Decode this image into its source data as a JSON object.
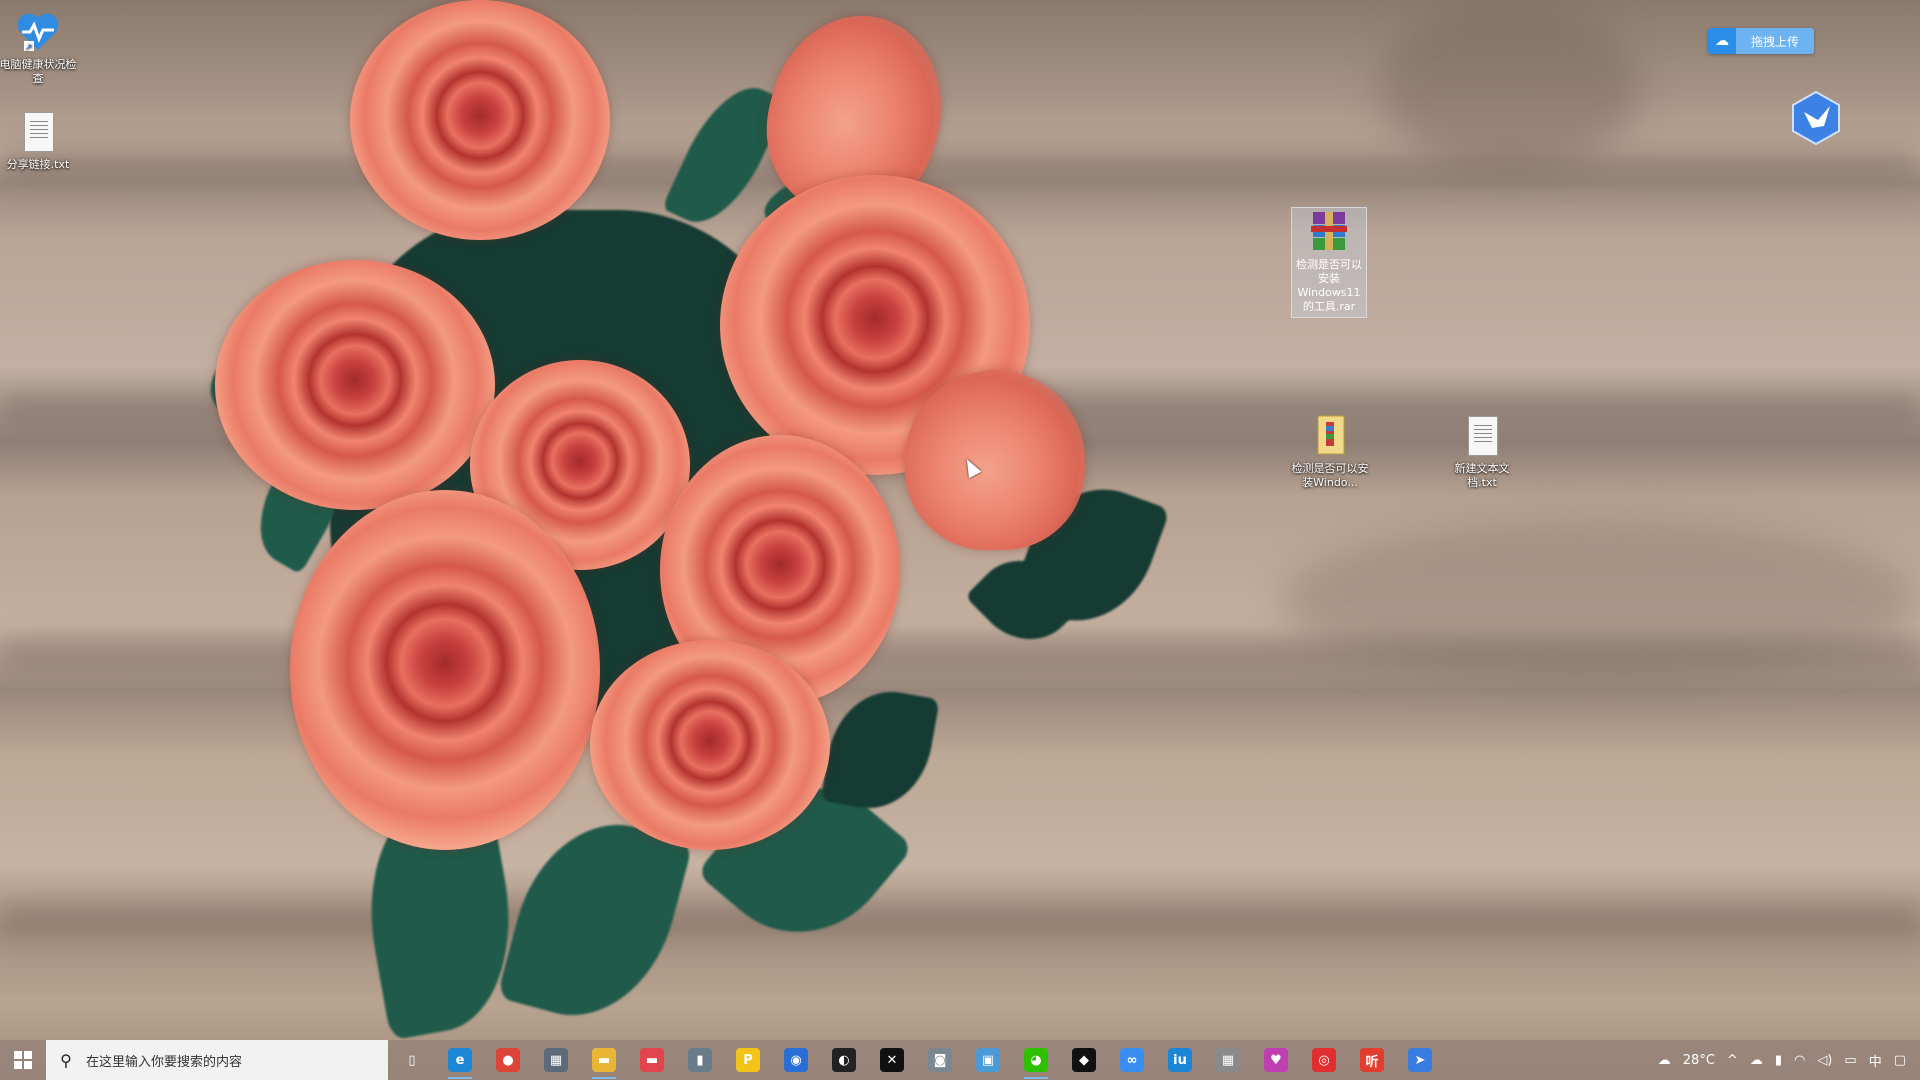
{
  "desktop": {
    "icons": [
      {
        "label": "电脑健康状况检查",
        "icon": "heart-monitor-icon"
      },
      {
        "label": "分享链接.txt",
        "icon": "text-file-icon"
      },
      {
        "label": "检测是否可以安装Windows11的工具.rar",
        "icon": "winrar-archive-icon"
      },
      {
        "label": "检测是否可以安装Windo...",
        "icon": "folder-zip-icon"
      },
      {
        "label": "新建文本文档.txt",
        "icon": "text-file-icon"
      }
    ]
  },
  "widgets": {
    "upload_label": "拖拽上传",
    "upload_icon": "baidu-cloud-icon",
    "bird_icon": "bird-app-icon"
  },
  "taskbar": {
    "search_placeholder": "在这里输入你要搜索的内容",
    "apps": [
      {
        "name": "task-view",
        "icon": "task-view-icon",
        "glyph": "▯",
        "color": "transparent"
      },
      {
        "name": "edge",
        "icon": "edge-icon",
        "glyph": "e",
        "color": "#1e88d6"
      },
      {
        "name": "chrome",
        "icon": "chrome-icon",
        "glyph": "●",
        "color": "#db4437"
      },
      {
        "name": "store",
        "icon": "store-icon",
        "glyph": "▦",
        "color": "#5c6a7a"
      },
      {
        "name": "explorer",
        "icon": "folder-icon",
        "glyph": "▬",
        "color": "#e8b534"
      },
      {
        "name": "app-red",
        "icon": "red-app-icon",
        "glyph": "▬",
        "color": "#e0464b"
      },
      {
        "name": "bottle",
        "icon": "bottle-icon",
        "glyph": "▮",
        "color": "#6a7c8c"
      },
      {
        "name": "player",
        "icon": "player-icon",
        "glyph": "P",
        "color": "#f2c318"
      },
      {
        "name": "browser",
        "icon": "globe-icon",
        "glyph": "◉",
        "color": "#2a6fd6"
      },
      {
        "name": "aperture",
        "icon": "aperture-icon",
        "glyph": "◐",
        "color": "#222222"
      },
      {
        "name": "capcut",
        "icon": "capcut-icon",
        "glyph": "✕",
        "color": "#111111"
      },
      {
        "name": "camera",
        "icon": "camera-icon",
        "glyph": "◙",
        "color": "#7a8894"
      },
      {
        "name": "screenshot",
        "icon": "screenshot-icon",
        "glyph": "▣",
        "color": "#4b9ad8"
      },
      {
        "name": "wechat",
        "icon": "wechat-icon",
        "glyph": "◕",
        "color": "#2dc100"
      },
      {
        "name": "qq",
        "icon": "qq-penguin-icon",
        "glyph": "◆",
        "color": "#111111"
      },
      {
        "name": "baidu-netdisk",
        "icon": "baidu-netdisk-icon",
        "glyph": "∞",
        "color": "#3a8ef0"
      },
      {
        "name": "iqiyi",
        "icon": "iqiyi-icon",
        "glyph": "iu",
        "color": "#1c86d6"
      },
      {
        "name": "calculator",
        "icon": "calculator-icon",
        "glyph": "▦",
        "color": "#8a8a8a"
      },
      {
        "name": "colorful",
        "icon": "colorful-app-icon",
        "glyph": "♥",
        "color": "#c03fb0"
      },
      {
        "name": "netease-music",
        "icon": "netease-music-icon",
        "glyph": "◎",
        "color": "#e02d2d"
      },
      {
        "name": "ting",
        "icon": "ting-icon",
        "glyph": "听",
        "color": "#e23c2c"
      },
      {
        "name": "bird",
        "icon": "bird-icon",
        "glyph": "➤",
        "color": "#3a7be0"
      }
    ],
    "tray": {
      "weather": "28°C",
      "ime": "中"
    }
  }
}
